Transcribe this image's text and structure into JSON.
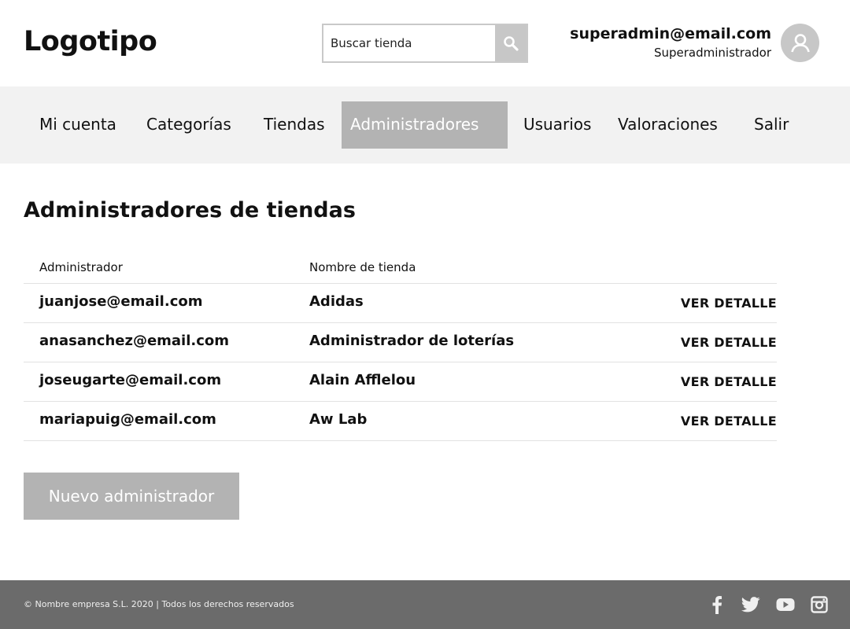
{
  "header": {
    "logo": "Logotipo",
    "search": {
      "placeholder": "Buscar tienda",
      "value": ""
    },
    "user": {
      "email": "superadmin@email.com",
      "role": "Superadministrador"
    }
  },
  "nav": {
    "items": [
      {
        "label": "Mi cuenta",
        "active": false
      },
      {
        "label": "Categorías",
        "active": false
      },
      {
        "label": "Tiendas",
        "active": false
      },
      {
        "label": "Administradores",
        "active": true
      },
      {
        "label": "Usuarios",
        "active": false
      },
      {
        "label": "Valoraciones",
        "active": false
      },
      {
        "label": "Salir",
        "active": false
      }
    ]
  },
  "main": {
    "title": "Administradores de tiendas",
    "table": {
      "headers": [
        "Administrador",
        "Nombre de tienda"
      ],
      "rows": [
        {
          "admin": "juanjose@email.com",
          "store": "Adidas",
          "action": "VER DETALLE"
        },
        {
          "admin": "anasanchez@email.com",
          "store": "Administrador de loterías",
          "action": "VER DETALLE"
        },
        {
          "admin": "joseugarte@email.com",
          "store": "Alain Afflelou",
          "action": "VER DETALLE"
        },
        {
          "admin": "mariapuig@email.com",
          "store": "Aw Lab",
          "action": "VER DETALLE"
        }
      ]
    },
    "new_button": "Nuevo administrador"
  },
  "footer": {
    "copyright": "© Nombre empresa S.L. 2020 | Todos los derechos reservados",
    "social": [
      "facebook-icon",
      "twitter-icon",
      "youtube-icon",
      "instagram-icon"
    ]
  },
  "colors": {
    "nav_bg": "#f2f2f2",
    "active_bg": "#b3b3b3",
    "footer_bg": "#6b6b6b",
    "button_bg": "#b3b3b3"
  }
}
